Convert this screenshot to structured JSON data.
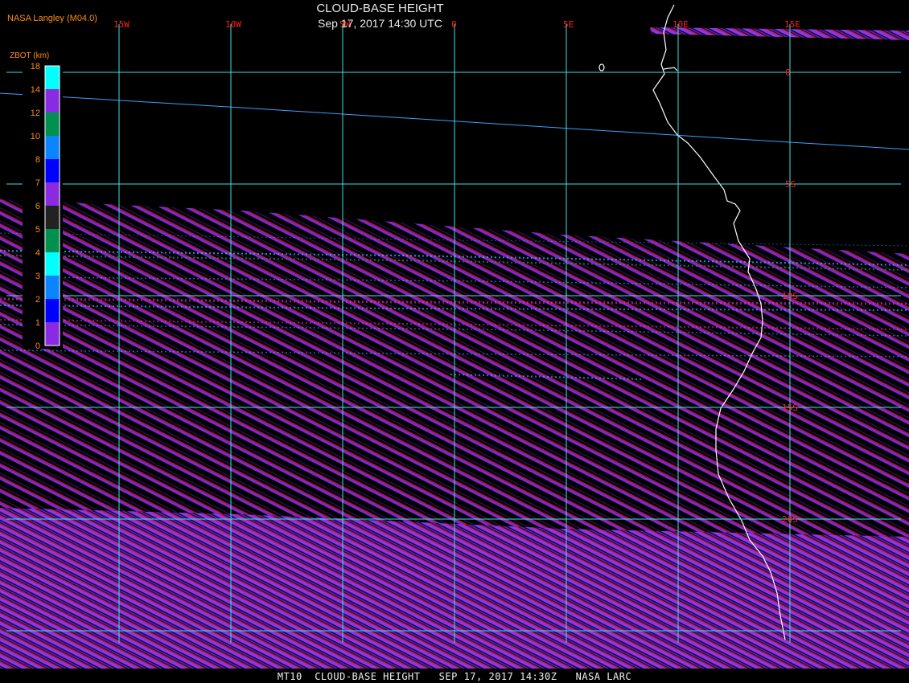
{
  "header": {
    "credit": "NASA Langley (M04.0)",
    "title": "CLOUD-BASE HEIGHT",
    "subtitle": "Sep 17, 2017 14:30 UTC"
  },
  "footer": {
    "caption": "MT10  CLOUD-BASE HEIGHT   SEP 17, 2017 14:30Z   NASA LARC"
  },
  "legend": {
    "label": "ZBOT (km)",
    "levels": [
      {
        "label": "18",
        "color": "#00ffff"
      },
      {
        "label": "14",
        "color": "#8a2be2"
      },
      {
        "label": "12",
        "color": "#009050"
      },
      {
        "label": "10",
        "color": "#0a84ff"
      },
      {
        "label": "8",
        "color": "#0000ff"
      },
      {
        "label": "7",
        "color": "#8a2be2"
      },
      {
        "label": "6",
        "color": "#222222"
      },
      {
        "label": "5",
        "color": "#009050"
      },
      {
        "label": "4",
        "color": "#00ffff"
      },
      {
        "label": "3",
        "color": "#0a84ff"
      },
      {
        "label": "2",
        "color": "#0000ff"
      },
      {
        "label": "1",
        "color": "#8a2be2"
      },
      {
        "label": "0",
        "color": null
      }
    ]
  },
  "grid": {
    "color": "#40e0e0",
    "label_color": "#ff2020",
    "longitudes": [
      {
        "label": "15W",
        "deg": -15
      },
      {
        "label": "10W",
        "deg": -10
      },
      {
        "label": "5W",
        "deg": -5
      },
      {
        "label": "0",
        "deg": 0
      },
      {
        "label": "5E",
        "deg": 5
      },
      {
        "label": "10E",
        "deg": 10
      },
      {
        "label": "15E",
        "deg": 15
      }
    ],
    "latitudes": [
      {
        "label": "0",
        "deg": 0
      },
      {
        "label": "5S",
        "deg": -5
      },
      {
        "label": "10S",
        "deg": -10
      },
      {
        "label": "15S",
        "deg": -15
      },
      {
        "label": "20S",
        "deg": -20
      }
    ]
  },
  "colors": {
    "background": "#000000",
    "swath_purple": "#7a2ad0",
    "swath_red": "#b01030",
    "coastline": "#ffffff",
    "orbit_track": "#3aa0ff"
  }
}
